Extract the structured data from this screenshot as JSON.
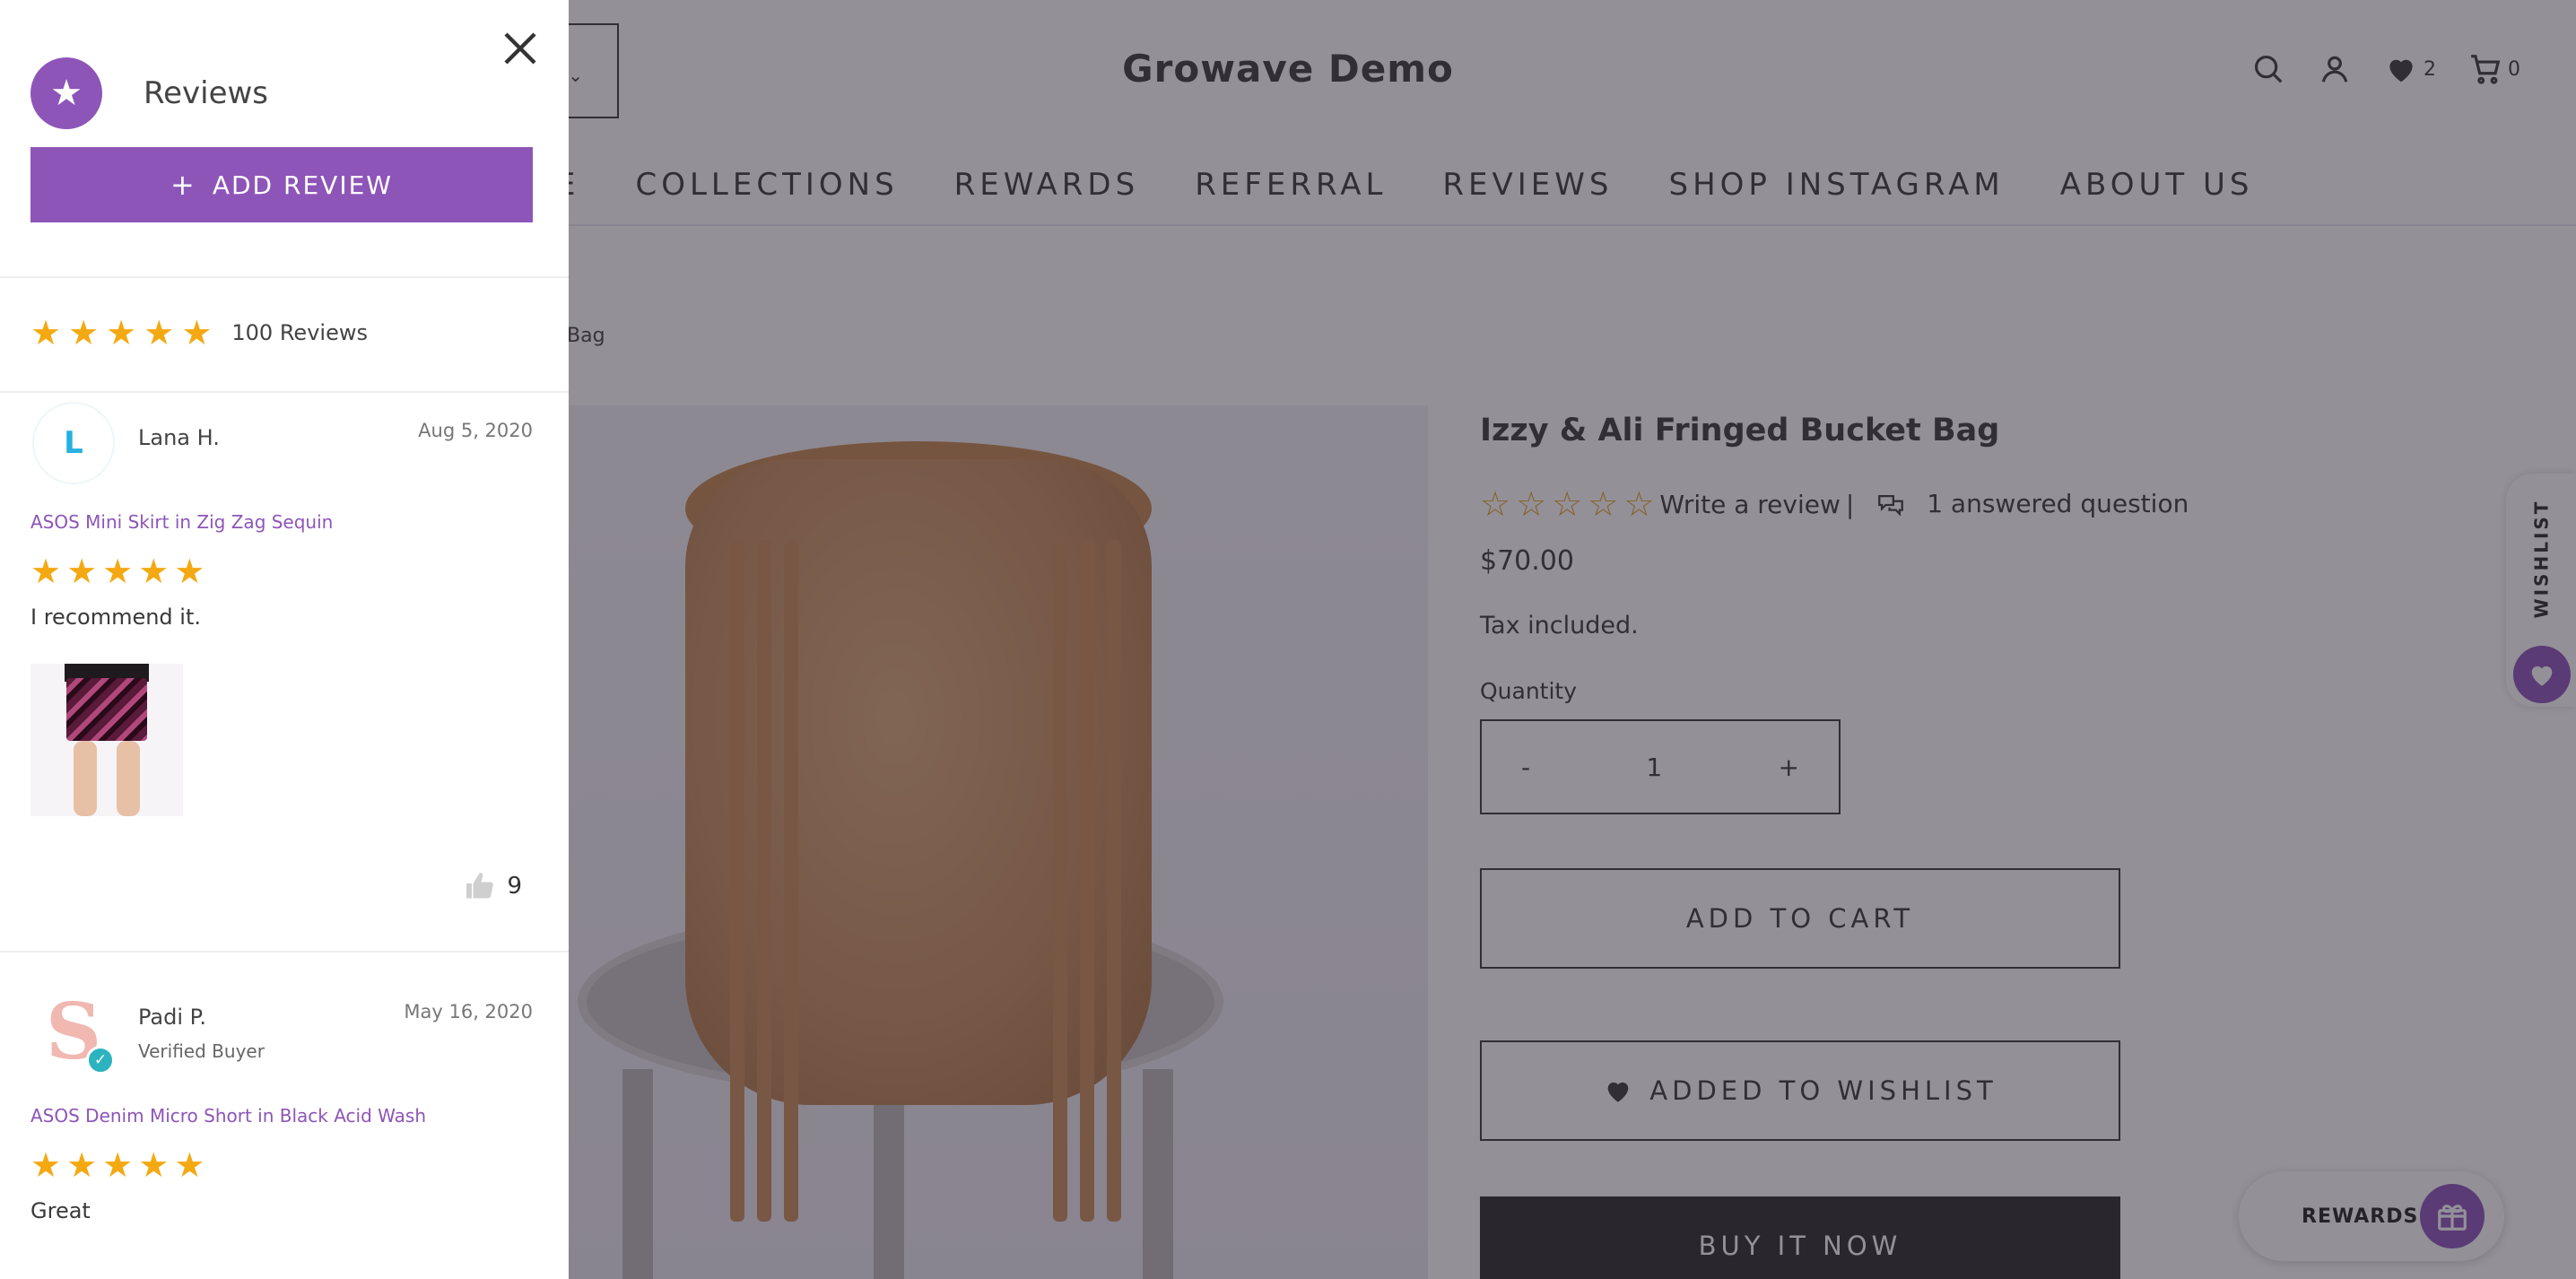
{
  "store": {
    "title": "Growave Demo",
    "wishlist_count": "2",
    "cart_count": "0",
    "nav": [
      "E",
      "COLLECTIONS",
      "REWARDS",
      "REFERRAL",
      "REVIEWS",
      "SHOP INSTAGRAM",
      "ABOUT US"
    ],
    "breadcrumb_tail": "Bag"
  },
  "product": {
    "title": "Izzy & Ali Fringed Bucket Bag",
    "rating_stars": 0,
    "write_review": "Write a review",
    "separator": "|",
    "answered": "1 answered question",
    "price": "$70.00",
    "tax": "Tax included.",
    "quantity_label": "Quantity",
    "qty_minus": "-",
    "qty_value": "1",
    "qty_plus": "+",
    "add_to_cart": "ADD TO CART",
    "added_to_wishlist": "ADDED TO WISHLIST",
    "buy_now": "BUY IT NOW"
  },
  "widgets": {
    "wishlist_tab": "WISHLIST",
    "rewards": "REWARDS"
  },
  "panel": {
    "title": "Reviews",
    "add_review_plus": "+",
    "add_review": "ADD REVIEW",
    "summary_stars": 5,
    "summary_count": "100 Reviews",
    "reviews": [
      {
        "avatar_letter": "L",
        "name": "Lana H.",
        "date": "Aug 5, 2020",
        "product": "ASOS Mini Skirt in Zig Zag Sequin",
        "stars": 5,
        "text": "I recommend it.",
        "likes": "9"
      },
      {
        "avatar_letter": "S",
        "name": "Padi P.",
        "badge": "Verified Buyer",
        "date": "May 16, 2020",
        "product": "ASOS Denim Micro Short in Black Acid Wash",
        "stars": 5,
        "text": "Great"
      }
    ]
  },
  "colors": {
    "accent": "#8d55b8",
    "star": "#f4a912",
    "overlay": "rgba(40,34,50,0.5)"
  }
}
